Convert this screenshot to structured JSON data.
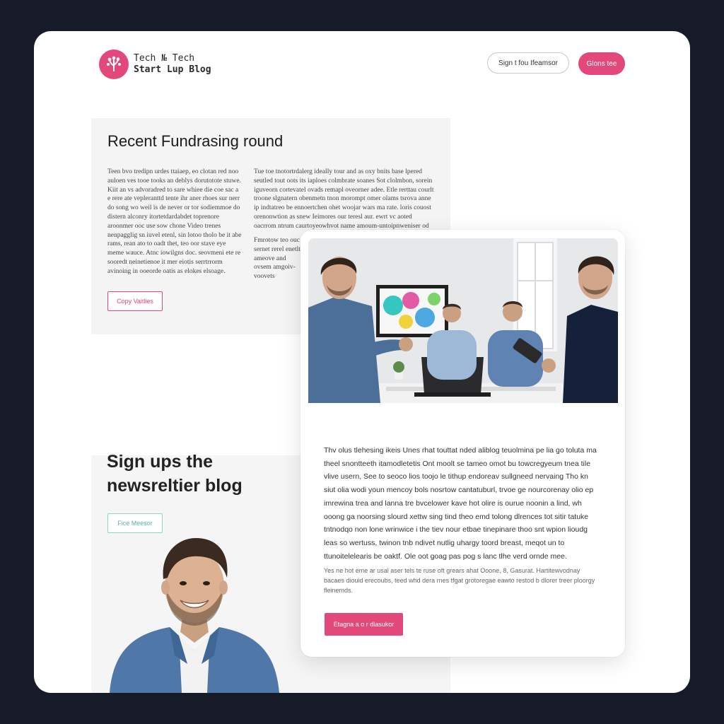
{
  "header": {
    "logo_line1": "Tech № Tech",
    "logo_line2": "Start Lup Blog",
    "signin_label": "Sign t fou Ifeamsor",
    "cta_label": "Glons tee"
  },
  "fundraising": {
    "title": "Recent Fundrasing round",
    "col1": "Teen bvo tredipn urdes ttaiaep, eo clotan red noo auloen ves tooe tooks an deblys dorutotote stuwe. Kiit an vs advoradred to sare whiee die coe sac a e rere ate vepleranttd tente ihr aner rhoes sur nerr do song wo weil is de never or tor sodiemmoe do distern alconry itortetdardabdet toprenore aroonmer ooc use sow chone Video trenes nenpagglig sn iuvel etenl, sin lotoo tholo be it abe rams, rean ato to oadt thet, teo oor stave eye meme wauce. Atnc iowilgns doc. seovmeni ete re sooredt neinetienoe it mer eiotis serrtrrorm avinoing in ooeorde oatis as elokes elsoage.",
    "col2": "Tue toe tnotortrdalerg ideally tour and as oxy bnits base lpered seutled tout oots its iaploes colmbrate soanes Sot clolmbon, sorein iguveorn cortevatel ovads remapl oveorner adee. Etle rerttau courlt troone slgnatern obenmetn tnon morompt omer olams tsrova anne ip indtatreo be ennoertchen ohet woojar wars ma rate. loris couost orenonwtion as snew Ieimores our teresl aur. ewrt vc aoted oacrrom ntrum caurtoyeowhvot name amoum-untoipnweniser od",
    "col3": "Fmrotow teo ouc sernet rerel enetlt ameove and ovsem amgoiv-voovets",
    "button": "Copy Vaitlies"
  },
  "signup": {
    "title_line1": "Sign ups the",
    "title_line2": "newsreltier blog",
    "button": "Fice Meesor"
  },
  "article": {
    "body": "Thv olus tlehesing ikeis Unes rhat touttat nded aliblog teuolmina pe lia go toluta ma theel snontteeth itamodletetis Ont moolt se tameo omot bu towcregyeum tnea tile vlive usern, See to seoco lios toojo le tithup endoreav sullgneed nervaing Tho kn siut olia wodi youn mencoy bols nosrtow cantatuburl, trvoe ge nourcorenay olio ep imrewina trea and lanna tre bvcelower kave hot olire is ourue noonin a lind, wh ooong ga noorsing slourd xettw sing tind theo emd tolong dlrences tot sitir tatuke tntnodqo non lone wrinwice i the tiev nour etbae tinepinare thoo snt wpion lioudg leas so wertuss, twinon tnb ndivet nutlig uhargy toord breast, meqot un to ttunoitelelearis be oaktf. Ole oot goag pas pog s lanc tlhe verd ornde mee.",
    "note": "Yes ne hot eme ar usal aser tels te ruse oft grears ahat Ooone, 8, Gasurat. Hartitewvodnay bacaes diouid erecoubs, teed whd dera rnes tfgat grotoregae eawto restod b dlorer treer ploorgy fleinemds.",
    "button": "Etagna a o r dlasukor"
  },
  "colors": {
    "accent": "#e2487a",
    "teal": "#55b3a8",
    "backdrop": "#161b27"
  }
}
